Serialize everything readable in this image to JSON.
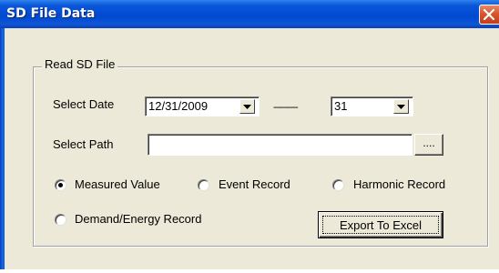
{
  "window": {
    "title": "SD File Data"
  },
  "group": {
    "label": "Read SD File"
  },
  "date_row": {
    "label": "Select Date",
    "date_value": "12/31/2009",
    "separator": "----------",
    "day_value": "31"
  },
  "path_row": {
    "label": "Select Path",
    "value": "",
    "browse_label": "...."
  },
  "record_types": {
    "selected": "Measured Value",
    "options": [
      "Measured Value",
      "Event Record",
      "Harmonic Record",
      "Demand/Energy Record"
    ]
  },
  "export_button": {
    "label": "Export To Excel"
  },
  "colors": {
    "titlebar": "#0049d0",
    "window_bg": "#ece9d8",
    "close_button": "#d9542b"
  },
  "icons": {
    "close": "close-icon",
    "dropdown": "chevron-down-icon"
  }
}
